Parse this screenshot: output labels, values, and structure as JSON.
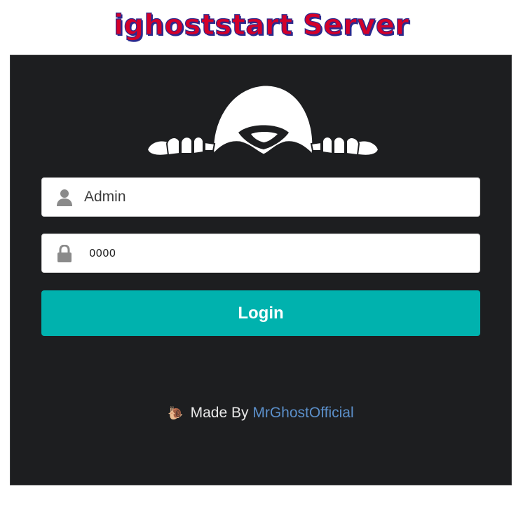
{
  "header": {
    "title": "ighoststart Server"
  },
  "login_form": {
    "username_value": "Admin",
    "password_value": "0000",
    "login_label": "Login",
    "icons": {
      "username": "user-icon",
      "password": "lock-icon",
      "logo": "hooded-ghost-logo"
    }
  },
  "footer": {
    "icon": "snail-icon",
    "snail_glyph": "🐌",
    "made_by_label": "Made By",
    "author": "MrGhostOfficial"
  },
  "colors": {
    "title_red": "#d3002a",
    "title_outline": "#2b2a8e",
    "panel_background": "#1d1e20",
    "button_teal": "#00b2ae",
    "link_blue": "#5b8fc9"
  }
}
